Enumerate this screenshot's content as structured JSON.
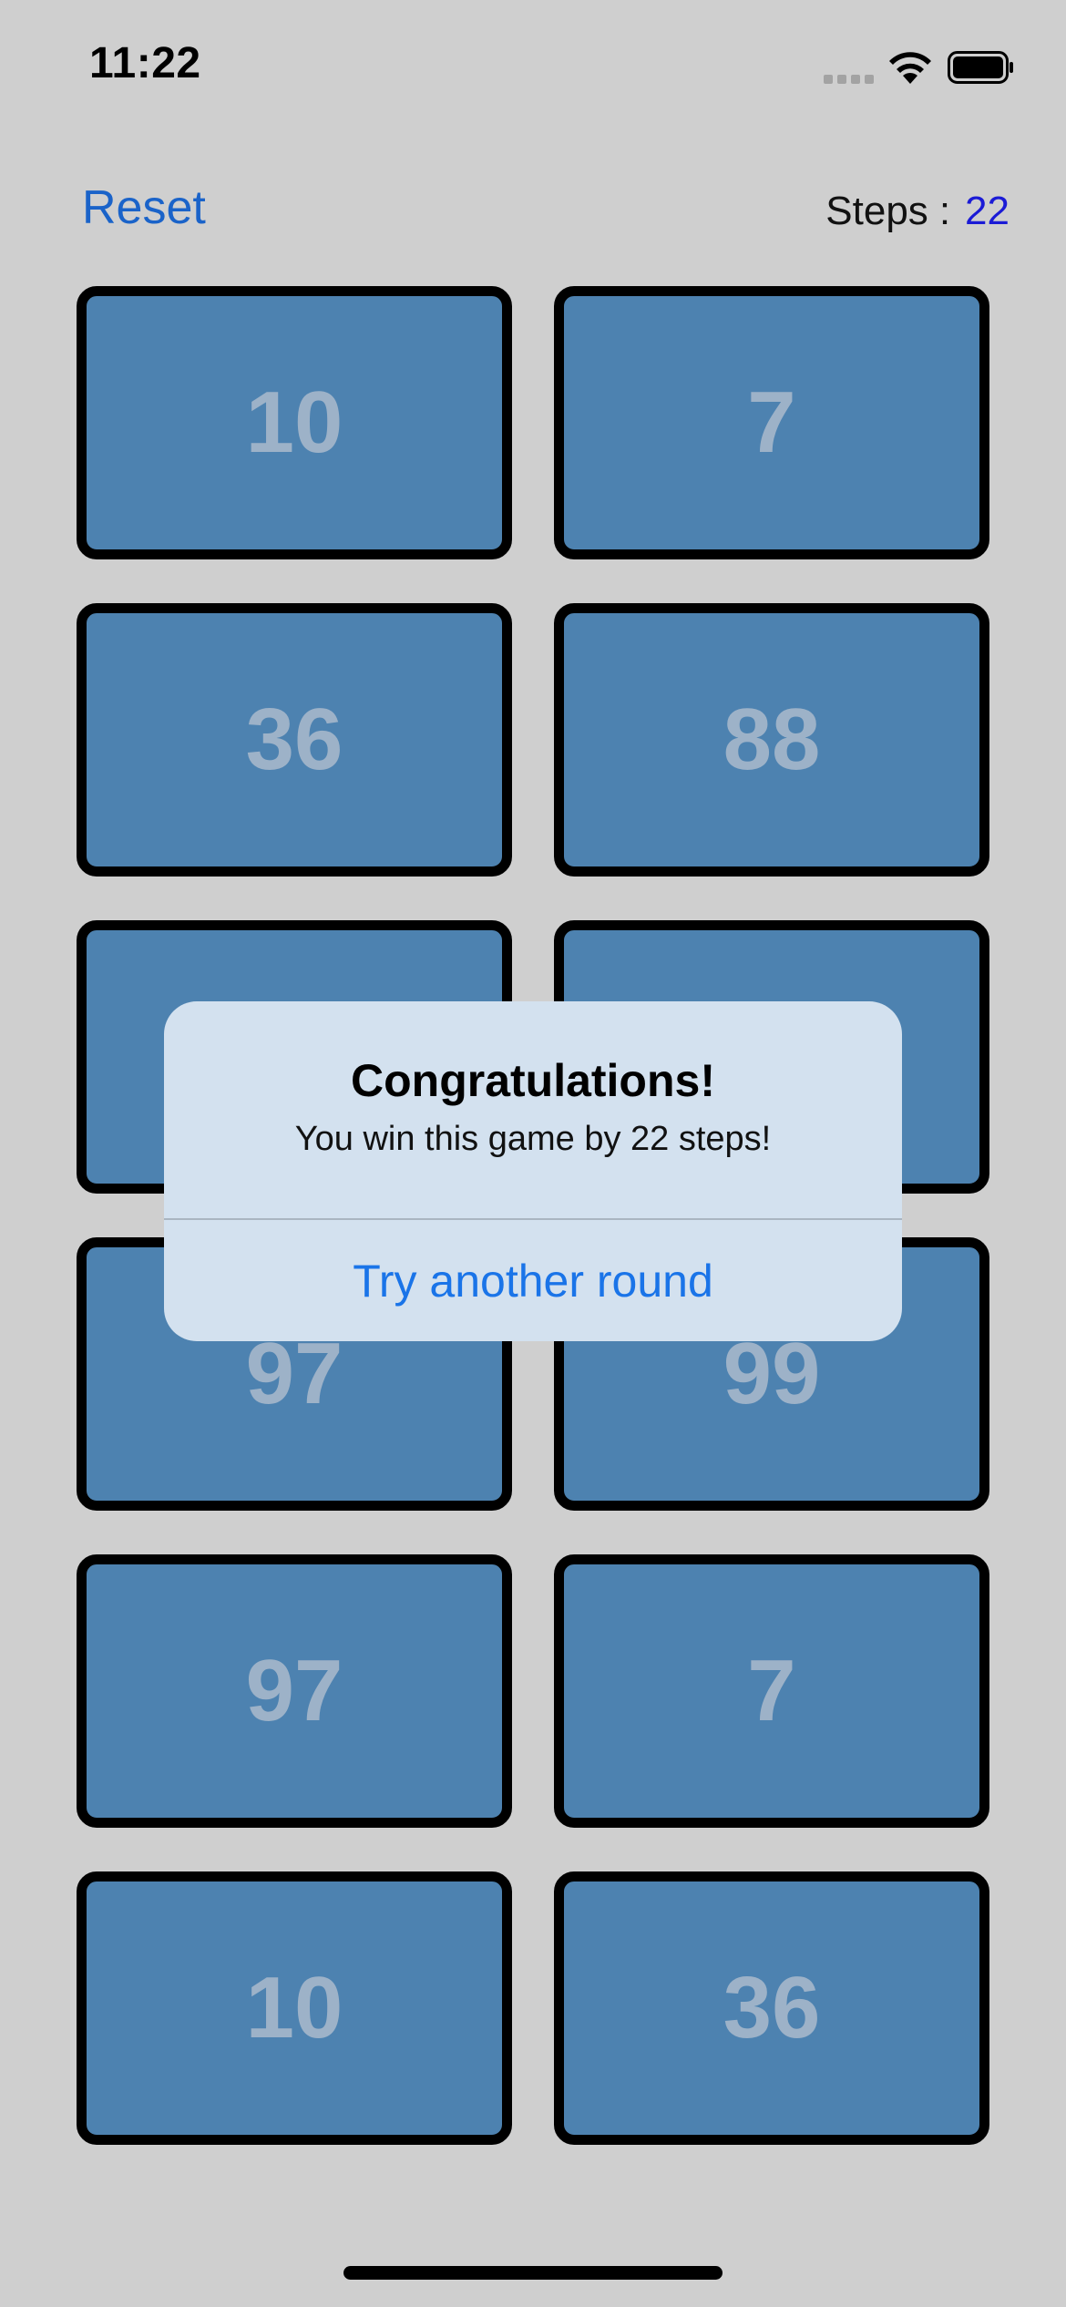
{
  "status_bar": {
    "time": "11:22",
    "icons": [
      "signal-icon",
      "wifi-icon",
      "battery-icon"
    ]
  },
  "header": {
    "reset_label": "Reset",
    "steps_label": "Steps",
    "steps_separator": ":",
    "steps_value": "22"
  },
  "cards": [
    {
      "value": "10"
    },
    {
      "value": "7"
    },
    {
      "value": "36"
    },
    {
      "value": "88"
    },
    {
      "value": ""
    },
    {
      "value": ""
    },
    {
      "value": "97"
    },
    {
      "value": "99"
    },
    {
      "value": "97"
    },
    {
      "value": "7"
    },
    {
      "value": "10"
    },
    {
      "value": "36"
    }
  ],
  "alert": {
    "title": "Congratulations!",
    "message": "You win this game by 22 steps!",
    "action_label": "Try another round"
  },
  "colors": {
    "background": "#cfcfcf",
    "card_fill": "#4d82b0",
    "card_border": "#000000",
    "card_text": "#9db2c8",
    "accent": "#1a63c9",
    "steps_value": "#1b1bd6",
    "alert_background": "#d3e1ef",
    "alert_action": "#1a74e8"
  }
}
